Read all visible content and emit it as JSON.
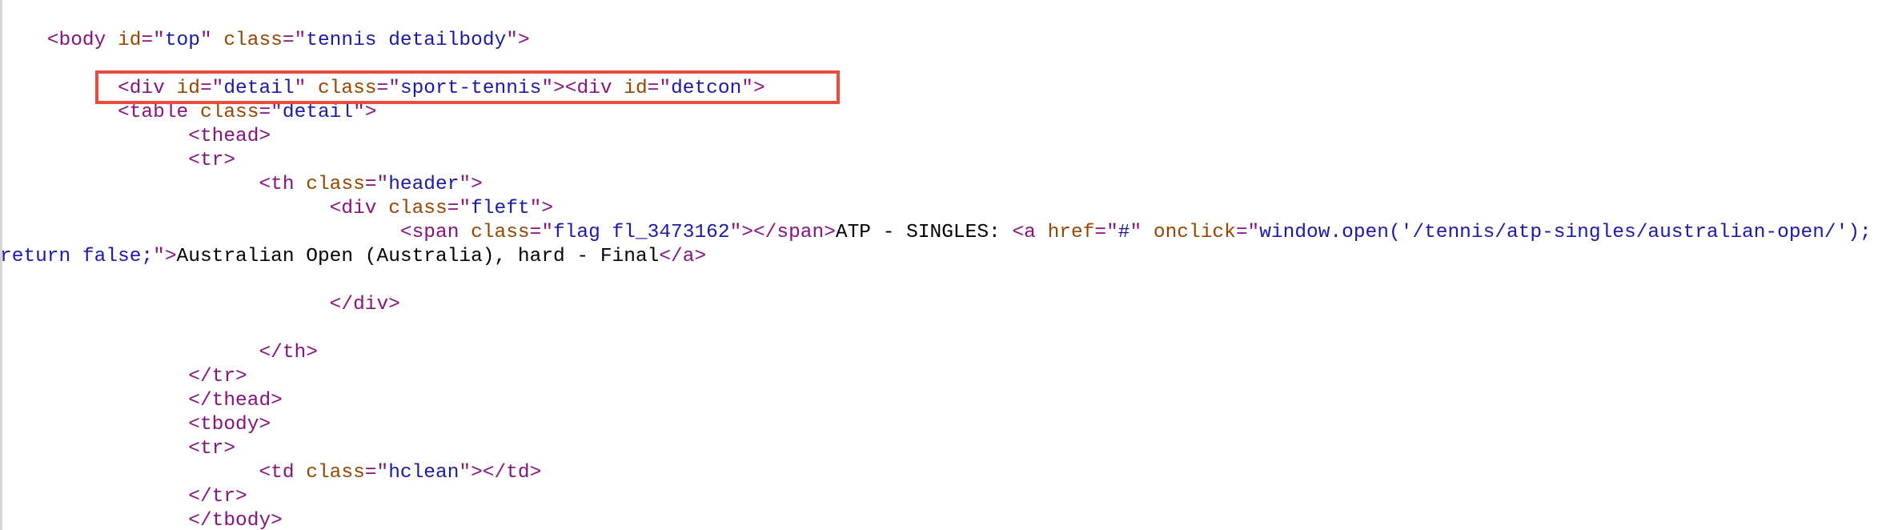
{
  "source_lines": [
    [
      [
        "t",
        "    <body "
      ],
      [
        "a",
        "id"
      ],
      [
        "t",
        "=\""
      ],
      [
        "v",
        "top"
      ],
      [
        "t",
        "\" "
      ],
      [
        "a",
        "class"
      ],
      [
        "t",
        "=\""
      ],
      [
        "v",
        "tennis detailbody"
      ],
      [
        "t",
        "\">"
      ]
    ],
    [],
    [
      [
        "t",
        "          <div "
      ],
      [
        "a",
        "id"
      ],
      [
        "t",
        "=\""
      ],
      [
        "v",
        "detail"
      ],
      [
        "t",
        "\" "
      ],
      [
        "a",
        "class"
      ],
      [
        "t",
        "=\""
      ],
      [
        "v",
        "sport-tennis"
      ],
      [
        "t",
        "\"><div "
      ],
      [
        "a",
        "id"
      ],
      [
        "t",
        "=\""
      ],
      [
        "v",
        "detcon"
      ],
      [
        "t",
        "\">"
      ]
    ],
    [
      [
        "t",
        "          <table "
      ],
      [
        "a",
        "class"
      ],
      [
        "t",
        "=\""
      ],
      [
        "v",
        "detail"
      ],
      [
        "t",
        "\">"
      ]
    ],
    [
      [
        "t",
        "                <thead>"
      ]
    ],
    [
      [
        "t",
        "                <tr>"
      ]
    ],
    [
      [
        "t",
        "                      <th "
      ],
      [
        "a",
        "class"
      ],
      [
        "t",
        "=\""
      ],
      [
        "v",
        "header"
      ],
      [
        "t",
        "\">"
      ]
    ],
    [
      [
        "t",
        "                            <div "
      ],
      [
        "a",
        "class"
      ],
      [
        "t",
        "=\""
      ],
      [
        "v",
        "fleft"
      ],
      [
        "t",
        "\">"
      ]
    ],
    [
      [
        "t",
        "                                  <span "
      ],
      [
        "a",
        "class"
      ],
      [
        "t",
        "=\""
      ],
      [
        "v",
        "flag fl_3473162"
      ],
      [
        "t",
        "\"></span>"
      ],
      [
        "x",
        "ATP - SINGLES: "
      ],
      [
        "t",
        "<a "
      ],
      [
        "a",
        "href"
      ],
      [
        "t",
        "=\""
      ],
      [
        "v",
        "#"
      ],
      [
        "t",
        "\" "
      ],
      [
        "a",
        "onclick"
      ],
      [
        "t",
        "=\""
      ],
      [
        "v",
        "window.open('/tennis/atp-singles/australian-open/');"
      ]
    ],
    [
      [
        "v",
        "return false;"
      ],
      [
        "t",
        "\">"
      ],
      [
        "x",
        "Australian Open (Australia), hard - Final"
      ],
      [
        "t",
        "</a>"
      ]
    ],
    [],
    [
      [
        "t",
        "                            </div>"
      ]
    ],
    [],
    [
      [
        "t",
        "                      </th>"
      ]
    ],
    [
      [
        "t",
        "                </tr>"
      ]
    ],
    [
      [
        "t",
        "                </thead>"
      ]
    ],
    [
      [
        "t",
        "                <tbody>"
      ]
    ],
    [
      [
        "t",
        "                <tr>"
      ]
    ],
    [
      [
        "t",
        "                      <td "
      ],
      [
        "a",
        "class"
      ],
      [
        "t",
        "=\""
      ],
      [
        "v",
        "hclean"
      ],
      [
        "t",
        "\"></td>"
      ]
    ],
    [
      [
        "t",
        "                </tr>"
      ]
    ],
    [
      [
        "t",
        "                </tbody>"
      ]
    ]
  ],
  "highlight": {
    "line_index": 2,
    "color": "#e74c3c"
  },
  "colors": {
    "tag": "#881280",
    "attribute_name": "#994500",
    "attribute_value": "#1a1aa6",
    "text": "#000000"
  }
}
